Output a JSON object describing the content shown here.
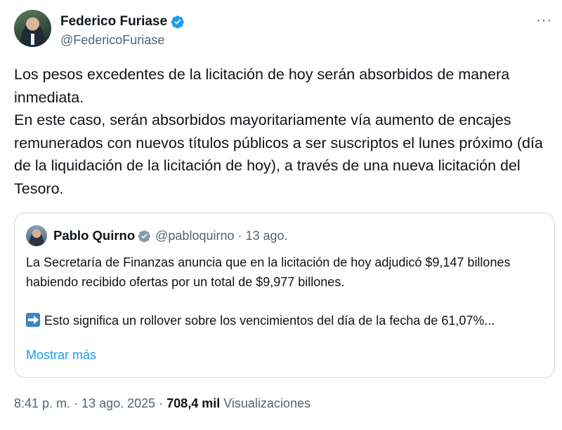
{
  "author": {
    "name": "Federico Furiase",
    "handle": "@FedericoFuriase",
    "verified": true
  },
  "more_label": "···",
  "tweet": {
    "paragraphs": [
      "Los pesos excedentes de la licitación de hoy serán absorbidos de manera inmediata.",
      "En este caso, serán absorbidos mayoritariamente vía aumento de encajes remunerados con nuevos títulos públicos a ser suscriptos el lunes próximo (día de la liquidación de la licitación de hoy), a través de una nueva licitación del Tesoro."
    ]
  },
  "quote": {
    "name": "Pablo Quirno",
    "handle": "@pabloquirno",
    "dot": "·",
    "date": "13 ago.",
    "verified": true,
    "verified_color": "#829aab",
    "line1": "La Secretaría de Finanzas anuncia que en la licitación de hoy adjudicó $9,147 billones habiendo recibido ofertas por un total de $9,977 billones.",
    "line2": "Esto significa un rollover sobre los vencimientos del día de la fecha de 61,07%...",
    "show_more": "Mostrar más"
  },
  "meta": {
    "time": "8:41 p. m.",
    "sep1": "·",
    "date": "13 ago. 2025",
    "sep2": "·",
    "views_count": "708,4 mil",
    "views_label": "Visualizaciones"
  },
  "colors": {
    "verified_blue": "#1d9bf0",
    "link": "#1d9bf0",
    "secondary_text": "#536471"
  }
}
